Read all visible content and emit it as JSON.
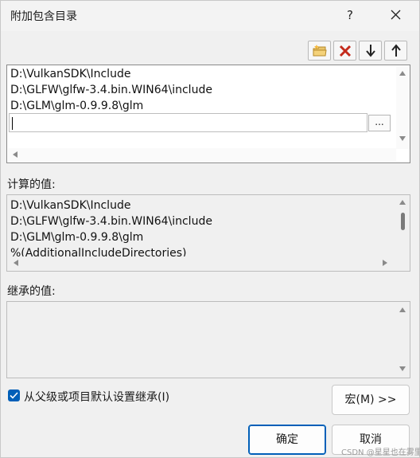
{
  "window": {
    "title": "附加包含目录",
    "help_label": "?"
  },
  "toolbar": {
    "icons": [
      "new-folder-icon",
      "delete-icon",
      "move-down-icon",
      "move-up-icon"
    ]
  },
  "include_list": {
    "items": [
      "D:\\VulkanSDK\\Include",
      "D:\\GLFW\\glfw-3.4.bin.WIN64\\include",
      "D:\\GLM\\glm-0.9.9.8\\glm"
    ],
    "edit_value": "",
    "browse_label": "..."
  },
  "computed": {
    "label": "计算的值:",
    "items": [
      "D:\\VulkanSDK\\Include",
      "D:\\GLFW\\glfw-3.4.bin.WIN64\\include",
      "D:\\GLM\\glm-0.9.9.8\\glm",
      "%(AdditionalIncludeDirectories)"
    ]
  },
  "inherited": {
    "label": "继承的值:",
    "items": []
  },
  "inherit_checkbox": {
    "label": "从父级或项目默认设置继承(I)",
    "checked": true
  },
  "buttons": {
    "macro": "宏(M) >>",
    "ok": "确定",
    "cancel": "取消"
  },
  "watermark": "CSDN @星星也在雾里",
  "colors": {
    "accent": "#005fb8",
    "delete_red": "#c42b1c"
  }
}
